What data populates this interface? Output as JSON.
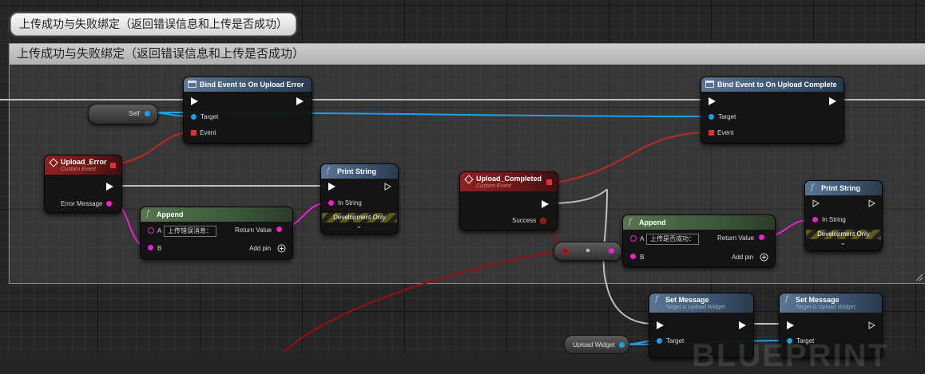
{
  "comment_bubble": "上传成功与失败绑定（返回错误信息和上传是否成功）",
  "comment_title": "上传成功与失败绑定（返回错误信息和上传是否成功）",
  "colors": {
    "exec": "#ffffff",
    "object": "#1ea0e8",
    "string": "#f01fd0",
    "delegate": "#e03030",
    "boolean": "#9a0e0e"
  },
  "self_node": {
    "label": "Self"
  },
  "bind_error": {
    "title": "Bind Event to On Upload Error",
    "target": "Target",
    "event": "Event"
  },
  "bind_complete": {
    "title": "Bind Event to On Upload Complete",
    "target": "Target",
    "event": "Event"
  },
  "upload_error": {
    "title": "Upload_Error",
    "subtitle": "Custom Event",
    "pin": "Error Message"
  },
  "upload_completed": {
    "title": "Upload_Completed",
    "subtitle": "Custom Event",
    "pin": "Success"
  },
  "append1": {
    "title": "Append",
    "pin_a": "A",
    "value_a": "上传错误消息：",
    "pin_b": "B",
    "return": "Return Value",
    "add_pin": "Add pin"
  },
  "append2": {
    "title": "Append",
    "pin_a": "A",
    "value_a": "上传是否成功：",
    "pin_b": "B",
    "return": "Return Value",
    "add_pin": "Add pin"
  },
  "print1": {
    "title": "Print String",
    "pin": "In String",
    "dev": "Development Only"
  },
  "print2": {
    "title": "Print String",
    "pin": "In String",
    "dev": "Development Only"
  },
  "set_msg1": {
    "title": "Set Message",
    "subtitle": "Target is Upload Widget",
    "target": "Target"
  },
  "set_msg2": {
    "title": "Set Message",
    "subtitle": "Target is Upload Widget",
    "target": "Target"
  },
  "widget_var": {
    "label": "Upload Widget"
  },
  "watermark": "BLUEPRINT"
}
